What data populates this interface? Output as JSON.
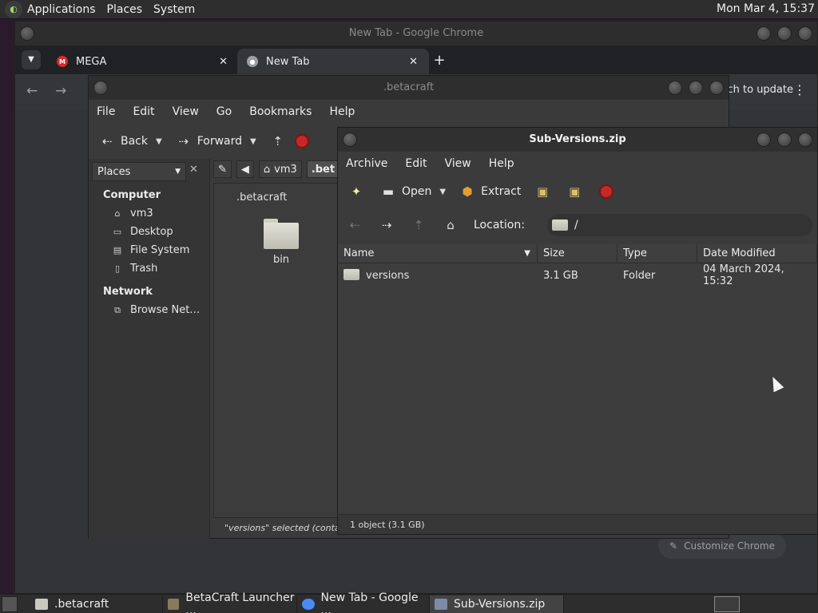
{
  "top_panel": {
    "menus": [
      "Applications",
      "Places",
      "System"
    ],
    "clock": "Mon Mar  4, 15:37"
  },
  "chrome": {
    "title": "New Tab - Google Chrome",
    "tabs": [
      {
        "label": "MEGA",
        "favicon": "mega-icon",
        "color": "#d9272e"
      },
      {
        "label": "New Tab",
        "favicon": "chrome-icon",
        "color": "#9aa0a6"
      }
    ],
    "relaunch_label": "nch to update",
    "customize_label": "Customize Chrome"
  },
  "caja": {
    "title": ".betacraft",
    "menus": [
      "File",
      "Edit",
      "View",
      "Go",
      "Bookmarks",
      "Help"
    ],
    "toolbar": {
      "back": "Back",
      "forward": "Forward"
    },
    "places_label": "Places",
    "sidebar": {
      "computer_heading": "Computer",
      "computer_items": [
        {
          "label": "vm3",
          "icon": "home-icon"
        },
        {
          "label": "Desktop",
          "icon": "desktop-icon"
        },
        {
          "label": "File System",
          "icon": "drive-icon"
        },
        {
          "label": "Trash",
          "icon": "trash-icon"
        }
      ],
      "network_heading": "Network",
      "network_items": [
        {
          "label": "Browse Net…",
          "icon": "network-icon"
        }
      ]
    },
    "pathbar": [
      "vm3",
      ".bet"
    ],
    "view_title": ".betacraft",
    "items": [
      {
        "label": "bin",
        "icon": "folder-icon"
      }
    ],
    "status": "\"versions\" selected (containi"
  },
  "archive": {
    "title": "Sub-Versions.zip",
    "menus": [
      "Archive",
      "Edit",
      "View",
      "Help"
    ],
    "toolbar": {
      "open": "Open",
      "extract": "Extract"
    },
    "location_label": "Location:",
    "location_value": "/",
    "columns": [
      "Name",
      "Size",
      "Type",
      "Date Modified"
    ],
    "rows": [
      {
        "name": "versions",
        "size": "3.1 GB",
        "type": "Folder",
        "modified": "04 March 2024, 15:32"
      }
    ],
    "status": "1 object (3.1 GB)"
  },
  "taskbar": {
    "tasks": [
      {
        "label": ".betacraft",
        "icon": "folder-icon",
        "active": false
      },
      {
        "label": "BetaCraft Launcher ...",
        "icon": "java-icon",
        "active": false
      },
      {
        "label": "New Tab - Google ...",
        "icon": "chrome-icon",
        "active": false
      },
      {
        "label": "Sub-Versions.zip",
        "icon": "archive-icon",
        "active": true
      }
    ]
  }
}
